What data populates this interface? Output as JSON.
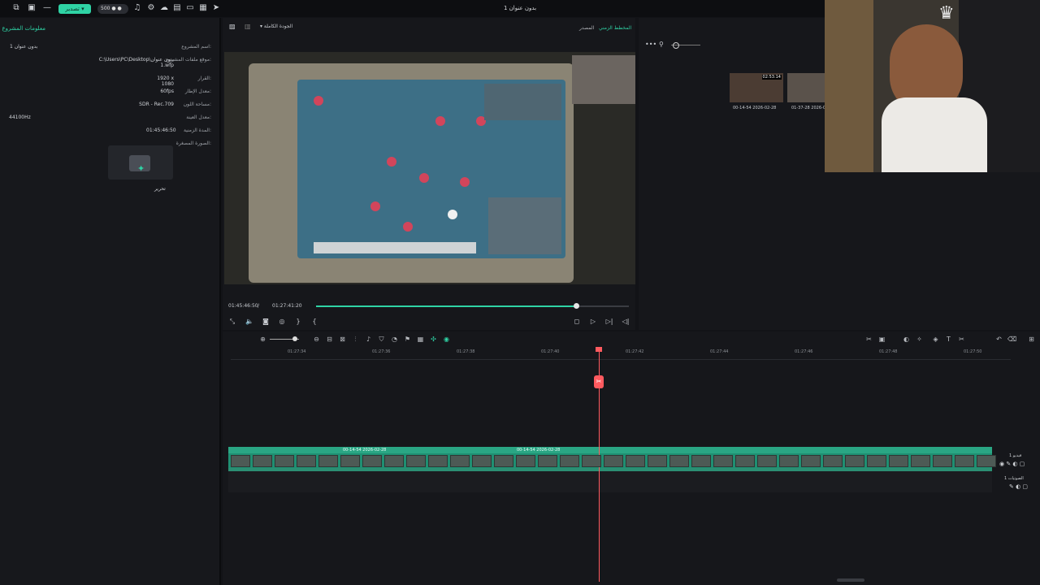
{
  "app": {
    "window_title": "بدون عنوان 1",
    "export_label": "تصدير",
    "credits": "500"
  },
  "left_panel": {
    "title": "معلومات المشروع",
    "fields": [
      {
        "label": "اسم المشروع:",
        "value": "بدون عنوان 1"
      },
      {
        "label": "موقع ملفات المشروع:",
        "value": "C:\\Users\\PC\\Desktop\\بدون عنوان 1.wfp"
      },
      {
        "label": "القرار:",
        "value": "1920 x 1080"
      },
      {
        "label": "معدل الإطار:",
        "value": "60fps"
      },
      {
        "label": "مساحة اللون:",
        "value": "SDR - Rec.709"
      },
      {
        "label": "معدل العينة:",
        "value": "44100Hz"
      },
      {
        "label": "المدة الزمنية:",
        "value": "01:45:46:50"
      },
      {
        "label": "الصورة المصغرة:",
        "value": ""
      }
    ],
    "edit_label": "تحرير"
  },
  "player": {
    "tab_timeline": "المخطط الزمني",
    "tab_source": "المصدر",
    "quality": "الجودة الكاملة",
    "current_time": "01:45:46:50",
    "separator": "/",
    "total_time": "01:27:41:20",
    "progress_fraction": 0.83
  },
  "media": {
    "clips": [
      {
        "name": "00-14-54 2026-02-28",
        "duration": "02:53:14"
      },
      {
        "name": "01-37-28 2026-02-"
      }
    ]
  },
  "timeline": {
    "ruler": [
      "01:27:34",
      "01:27:36",
      "01:27:38",
      "01:27:40",
      "01:27:42",
      "01:27:44",
      "01:27:46",
      "01:27:48",
      "01:27:50"
    ],
    "clip_labels": [
      "00-14-54 2026-02-28",
      "00-14-54 2026-02-28"
    ],
    "video_track_label": "فيديو 1",
    "audio_track_label": "الصوتيات 1"
  }
}
